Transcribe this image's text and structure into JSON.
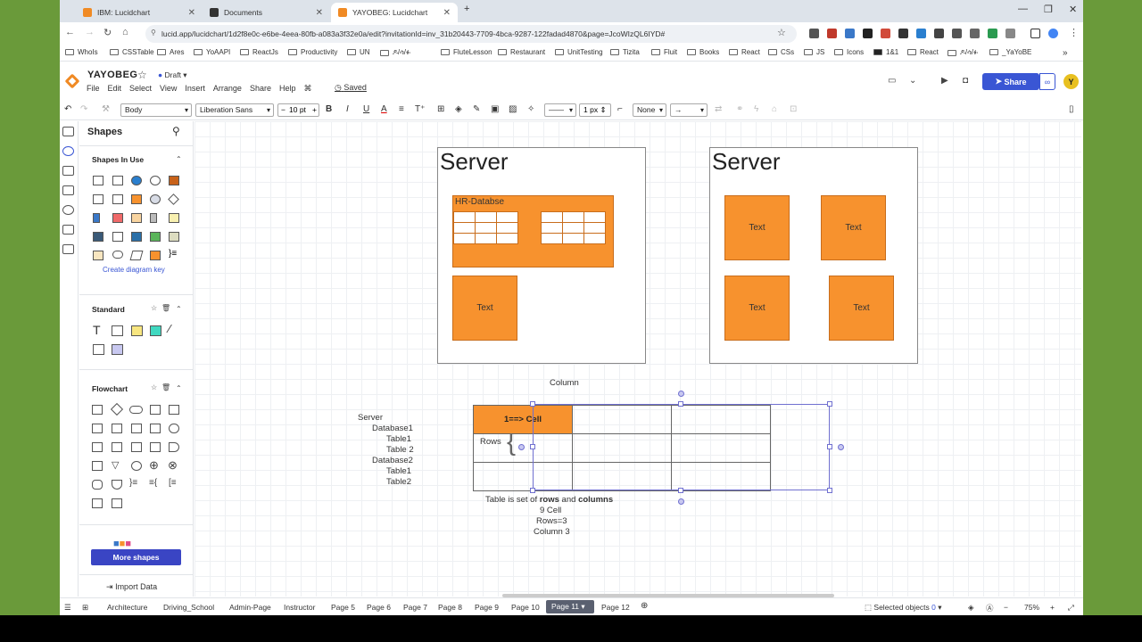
{
  "browser": {
    "tabs": [
      {
        "title": "IBM: Lucidchart",
        "color": "#f08a24"
      },
      {
        "title": "Documents",
        "color": "#333333"
      },
      {
        "title": "YAYOBEG: Lucidchart",
        "color": "#f08a24"
      }
    ],
    "url": "lucid.app/lucidchart/1d2f8e0c-e6be-4eea-80fb-a083a3f32e0a/edit?invitationId=inv_31b20443-7709-4bca-9287-122fadad4870&page=JcoWIzQL6IYD#",
    "bookmarks": [
      "WhoIs",
      "CSSTable",
      "Ares",
      "YoAAPI",
      "ReactJs",
      "Productivity",
      "UN",
      "ዶ/ሳ/ፉ",
      "FluteLesson",
      "Restaurant",
      "UnitTesting",
      "Tizita",
      "Fluit",
      "Books",
      "React",
      "CSs",
      "JS",
      "Icons",
      "1&1",
      "React",
      "ዶ/ሳ/ፉ",
      "_YaYoBE"
    ]
  },
  "app": {
    "doc_title": "YAYOBEG",
    "draft_label": "Draft",
    "menu": [
      "File",
      "Edit",
      "Select",
      "View",
      "Insert",
      "Arrange",
      "Share",
      "Help"
    ],
    "saved_label": "Saved",
    "share_label": "Share",
    "avatar_letter": "Y",
    "accent": "#3a56d4"
  },
  "toolbar": {
    "style": "Body",
    "font": "Liberation Sans",
    "font_size": "10 pt",
    "line_width": "1 px",
    "arrow_start": "None"
  },
  "shapes_panel": {
    "title": "Shapes",
    "in_use_title": "Shapes In Use",
    "create_key": "Create diagram key",
    "standard_title": "Standard",
    "flowchart_title": "Flowchart",
    "more_shapes": "More shapes",
    "import_data": "Import Data"
  },
  "canvas": {
    "server1_title": "Server",
    "server2_title": "Server",
    "db_label": "HR-Databse",
    "text_label": "Text",
    "column_label": "Column",
    "rows_label": "Rows",
    "cell_label": "1==> Cell",
    "tree": [
      "Server",
      "Database1",
      "Table1",
      "Table 2",
      "Database2",
      "Table1",
      "Table2"
    ],
    "note_prefix": "Table is set of ",
    "note_rows": "rows",
    "note_and": " and ",
    "note_columns": "columns",
    "note_lines": [
      "9  Cell",
      "Rows=3",
      "Column 3"
    ],
    "shape_color": "#f7922e"
  },
  "pages": {
    "tabs": [
      "Architecture",
      "Driving_School",
      "Admin-Page",
      "Instructor",
      "Page 5",
      "Page 6",
      "Page 7",
      "Page 8",
      "Page 9",
      "Page 10",
      "Page 11",
      "Page 12"
    ],
    "active": "Page 11",
    "selected_label": "Selected objects",
    "selected_count": "0",
    "zoom": "75%"
  }
}
